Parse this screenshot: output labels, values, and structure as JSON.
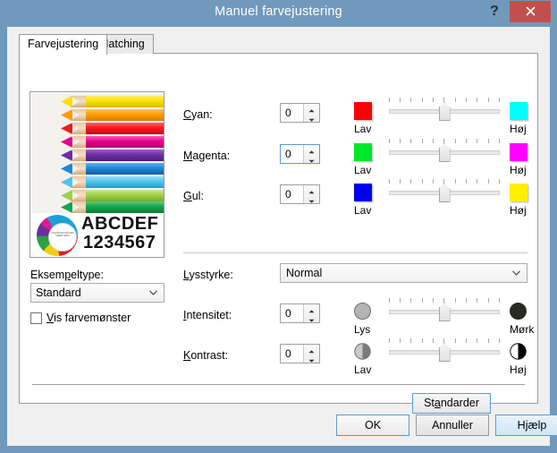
{
  "window": {
    "title": "Manuel farvejustering",
    "help_icon": "question-mark-icon",
    "close_icon": "close-icon",
    "titlebar_color": "#7199bb",
    "close_button_color": "#c0504d"
  },
  "tabs": [
    {
      "label": "Farvejustering",
      "active": true
    },
    {
      "label": "Matching",
      "active": false
    }
  ],
  "preview": {
    "sample_text_alpha": "ABCDEF",
    "sample_text_numeric": "1234567",
    "donut_center_text": "COLOR\nADJUST\nDATA SHEET\nCMYK",
    "pencil_colors": [
      "#ffe000",
      "#ff9d00",
      "#ee1c25",
      "#e4008c",
      "#6d2fa5",
      "#1e87d8",
      "#4ec3f0",
      "#9fd14a",
      "#15a44a"
    ]
  },
  "left_panel": {
    "eksempeltype_label": "Eksempeltype:",
    "eksempeltype_accel": "p",
    "eksempeltype_value": "Standard",
    "eksempeltype_options": [
      "Standard"
    ],
    "checkbox_label": "Vis farvemønster",
    "checkbox_accel": "V",
    "checkbox_checked": false
  },
  "color_rows": [
    {
      "label": "Cyan:",
      "accel": "C",
      "value": "0",
      "focused": false,
      "low_label": "Lav",
      "high_label": "Høj",
      "low_color": "#ff0000",
      "high_color": "#00ffff",
      "slider_percent": 50
    },
    {
      "label": "Magenta:",
      "accel": "M",
      "value": "0",
      "focused": true,
      "low_label": "Lav",
      "high_label": "Høj",
      "low_color": "#00e82a",
      "high_color": "#ff00ff",
      "slider_percent": 50
    },
    {
      "label": "Gul:",
      "accel": "G",
      "value": "0",
      "focused": false,
      "low_label": "Lav",
      "high_label": "Høj",
      "low_color": "#0000ee",
      "high_color": "#ffee00",
      "slider_percent": 50
    }
  ],
  "lysstyrke": {
    "label": "Lysstyrke:",
    "accel": "L",
    "value": "Normal",
    "options": [
      "Normal"
    ]
  },
  "tone_rows": [
    {
      "label": "Intensitet:",
      "accel": "I",
      "value": "0",
      "low_label": "Lys",
      "high_label": "Mørk",
      "low_icon": "light-circle-icon",
      "high_icon": "dark-circle-icon",
      "low_color": "#b4b4b4",
      "high_color": "#272a22",
      "slider_percent": 50
    },
    {
      "label": "Kontrast:",
      "accel": "K",
      "value": "0",
      "low_label": "Lav",
      "high_label": "Høj",
      "low_icon": "half-gray-circle-icon",
      "high_icon": "half-black-circle-icon",
      "low_color": "#b4b4b4",
      "high_color": "#000000",
      "slider_percent": 50
    }
  ],
  "buttons": {
    "standarder": "Standarder",
    "standarder_accel": "a",
    "ok": "OK",
    "cancel": "Annuller",
    "help": "Hjælp"
  }
}
